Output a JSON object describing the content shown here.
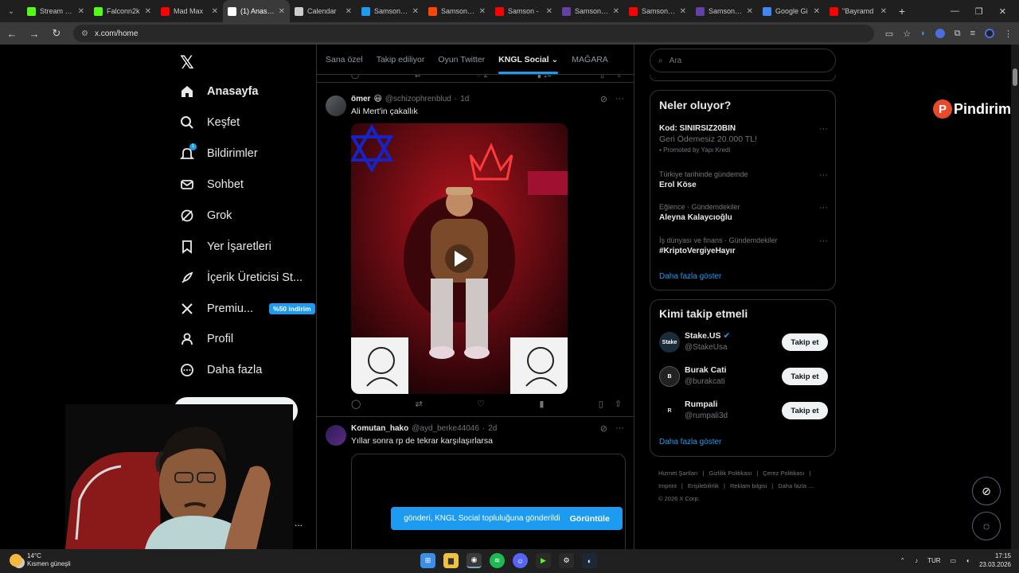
{
  "browser": {
    "tabs": [
      {
        "label": "Stream - K",
        "color": "#53fc18",
        "active": false
      },
      {
        "label": "Falconn2k",
        "color": "#53fc18",
        "active": false
      },
      {
        "label": "Mad Max",
        "color": "#ff0000",
        "active": false
      },
      {
        "label": "(1) Anasay",
        "color": "#ffffff",
        "active": true
      },
      {
        "label": "Calendar",
        "color": "#cccccc",
        "active": false
      },
      {
        "label": "Samson St",
        "color": "#1d9bf0",
        "active": false
      },
      {
        "label": "Samson: A",
        "color": "#ff4500",
        "active": false
      },
      {
        "label": "Samson -",
        "color": "#ff0000",
        "active": false
      },
      {
        "label": "Samson, A",
        "color": "#6441a5",
        "active": false
      },
      {
        "label": "Samson: A",
        "color": "#ff0000",
        "active": false
      },
      {
        "label": "Samson: A",
        "color": "#6441a5",
        "active": false
      },
      {
        "label": "Google Gi",
        "color": "#4285f4",
        "active": false
      },
      {
        "label": "\"Bayramd",
        "color": "#ff0000",
        "active": false
      }
    ],
    "url": "x.com/home"
  },
  "nav": {
    "items": [
      {
        "label": "Anasayfa",
        "icon": "home-icon"
      },
      {
        "label": "Keşfet",
        "icon": "search-icon"
      },
      {
        "label": "Bildirimler",
        "icon": "bell-icon",
        "badge": "1"
      },
      {
        "label": "Sohbet",
        "icon": "mail-icon"
      },
      {
        "label": "Grok",
        "icon": "grok-icon"
      },
      {
        "label": "Yer İşaretleri",
        "icon": "bookmark-icon"
      },
      {
        "label": "İçerik Üreticisi St...",
        "icon": "rocket-icon"
      },
      {
        "label": "Premiu...",
        "icon": "x-premium-icon",
        "badge_text": "%50 indirim"
      },
      {
        "label": "Profil",
        "icon": "person-icon"
      },
      {
        "label": "Daha fazla",
        "icon": "more-circle-icon"
      }
    ],
    "post_button": "Gönderi yayınla",
    "more": "..."
  },
  "feed": {
    "tabs": [
      "Sana özel",
      "Takip ediliyor",
      "Oyun Twitter",
      "KNGL Social",
      "MAĞARA"
    ],
    "active_tab": "KNGL Social",
    "prev_counts": {
      "likes": "2",
      "views": "14"
    },
    "posts": [
      {
        "name": "ömer",
        "handle": "@schizophrenblud",
        "time": "1d",
        "text": "Ali Mert'in çakallık"
      },
      {
        "name": "Komutan_hako",
        "handle": "@ayd_berke44046",
        "time": "2d",
        "text": "Yıllar sonra rp de tekrar karşılaşırlarsa"
      }
    ],
    "toast": {
      "text": "gönderi, KNGL Social topluluğuna gönderildi",
      "action": "Görüntüle"
    }
  },
  "sidebar_right": {
    "search_placeholder": "Ara",
    "trends_title": "Neler oluyor?",
    "trends": [
      {
        "category": "",
        "name": "Kod: SINIRSIZ20BIN",
        "sub": "Geri Ödemesiz 20.000 TL!",
        "promo": "Promoted by Yapı Kredi"
      },
      {
        "category": "Türkiye tarihinde gündemde",
        "name": "Erol Köse"
      },
      {
        "category": "Eğlence · Gündemdekiler",
        "name": "Aleyna Kalaycıoğlu"
      },
      {
        "category": "İş dünyası ve finans · Gündemdekiler",
        "name": "#KriptoVergiyeHayır"
      }
    ],
    "trends_more": "Daha fazla göster",
    "follow_title": "Kimi takip etmeli",
    "follow": [
      {
        "name": "Stake.US",
        "handle": "@StakeUsa",
        "btn": "Takip et"
      },
      {
        "name": "Burak Cati",
        "handle": "@burakcati",
        "btn": "Takip et"
      },
      {
        "name": "Rumpali",
        "handle": "@rumpali3d",
        "btn": "Takip et"
      }
    ],
    "follow_more": "Daha fazla göster",
    "footer": [
      "Hizmet Şartları",
      "|",
      "Gizlilik Politikası",
      "|",
      "Çerez Politikası",
      "|",
      "Imprint",
      "|",
      "Erişilebilirlik",
      "|",
      "Reklam bilgisi",
      "|",
      "Daha fazla ...",
      "© 2026 X Corp."
    ]
  },
  "overlay": {
    "brand": "Pindirim",
    "brand_letter": "P"
  },
  "taskbar": {
    "temp": "14°C",
    "weather": "Kısmen güneşli",
    "lang": "TUR",
    "time": "17:15",
    "date": "23.03.2026"
  }
}
